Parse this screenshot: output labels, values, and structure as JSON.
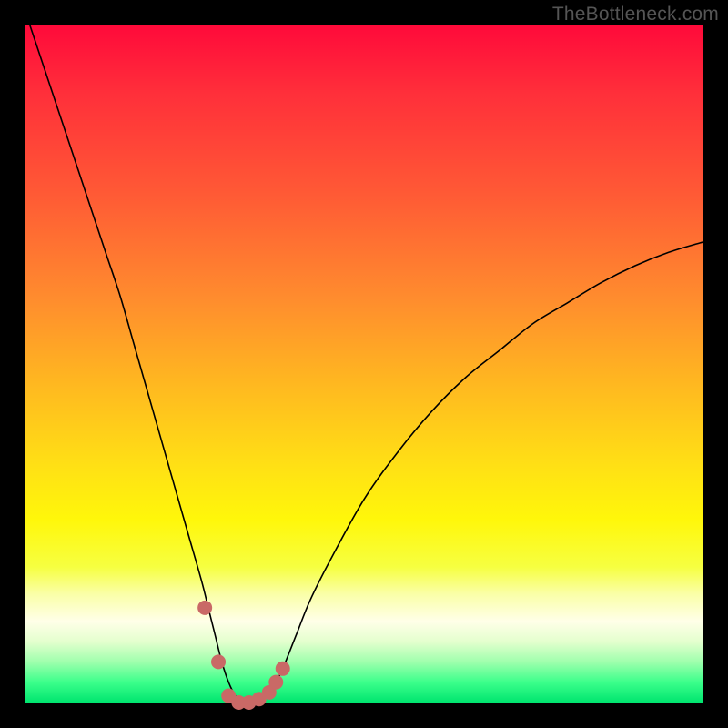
{
  "branding": {
    "watermark": "TheBottleneck.com"
  },
  "colors": {
    "background": "#000000",
    "gradient_top": "#ff0a3a",
    "gradient_bottom": "#00e56f",
    "curve": "#000000",
    "markers": "#c96966"
  },
  "chart_data": {
    "type": "line",
    "title": "",
    "xlabel": "",
    "ylabel": "",
    "xlim": [
      0,
      100
    ],
    "ylim": [
      0,
      100
    ],
    "x": [
      0,
      2,
      4,
      6,
      8,
      10,
      12,
      14,
      16,
      18,
      20,
      22,
      24,
      26,
      27,
      28,
      29,
      30,
      31,
      32,
      33,
      34,
      35,
      36,
      37,
      38,
      40,
      42,
      45,
      50,
      55,
      60,
      65,
      70,
      75,
      80,
      85,
      90,
      95,
      100
    ],
    "values": [
      102,
      96,
      90,
      84,
      78,
      72,
      66,
      60,
      53,
      46,
      39,
      32,
      25,
      18,
      14,
      10,
      6,
      3,
      1,
      0,
      0,
      0,
      0.5,
      1.5,
      3,
      5,
      10,
      15,
      21,
      30,
      37,
      43,
      48,
      52,
      56,
      59,
      62,
      64.5,
      66.5,
      68
    ],
    "markers_x": [
      26.5,
      28.5,
      30.0,
      31.5,
      33.0,
      34.5,
      36.0,
      37.0,
      38.0
    ],
    "markers_y": [
      14,
      6,
      1,
      0,
      0,
      0.5,
      1.5,
      3,
      5
    ]
  }
}
